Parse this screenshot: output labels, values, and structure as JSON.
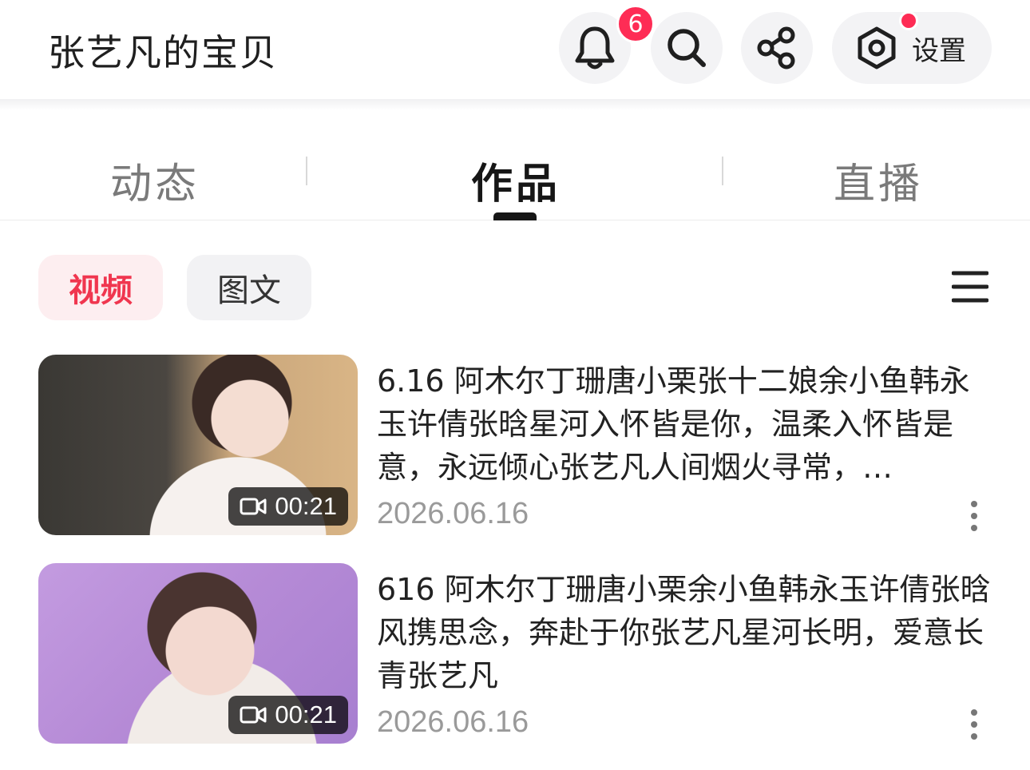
{
  "header": {
    "title": "张艺凡的宝贝",
    "notification_count": "6",
    "settings_label": "设置",
    "icons": [
      "bell-icon",
      "search-icon",
      "share-icon",
      "settings-icon"
    ],
    "badge_color": "#fe2c55"
  },
  "tabs": [
    {
      "label": "动态",
      "active": false
    },
    {
      "label": "作品",
      "active": true
    },
    {
      "label": "直播",
      "active": false
    }
  ],
  "filters": {
    "video_label": "视频",
    "image_text_label": "图文",
    "selected": "视频",
    "accent_color": "#f0364f"
  },
  "items": [
    {
      "title": "6.16 阿木尔丁珊唐小栗张十二娘余小鱼韩永玉许倩张晗星河入怀皆是你，温柔入怀皆是意，永远倾心张艺凡人间烟火寻常，…",
      "duration": "00:21",
      "date": "2026.06.16"
    },
    {
      "title": "616 阿木尔丁珊唐小栗余小鱼韩永玉许倩张晗风携思念，奔赴于你张艺凡星河长明，爱意长青张艺凡",
      "duration": "00:21",
      "date": "2026.06.16"
    }
  ]
}
